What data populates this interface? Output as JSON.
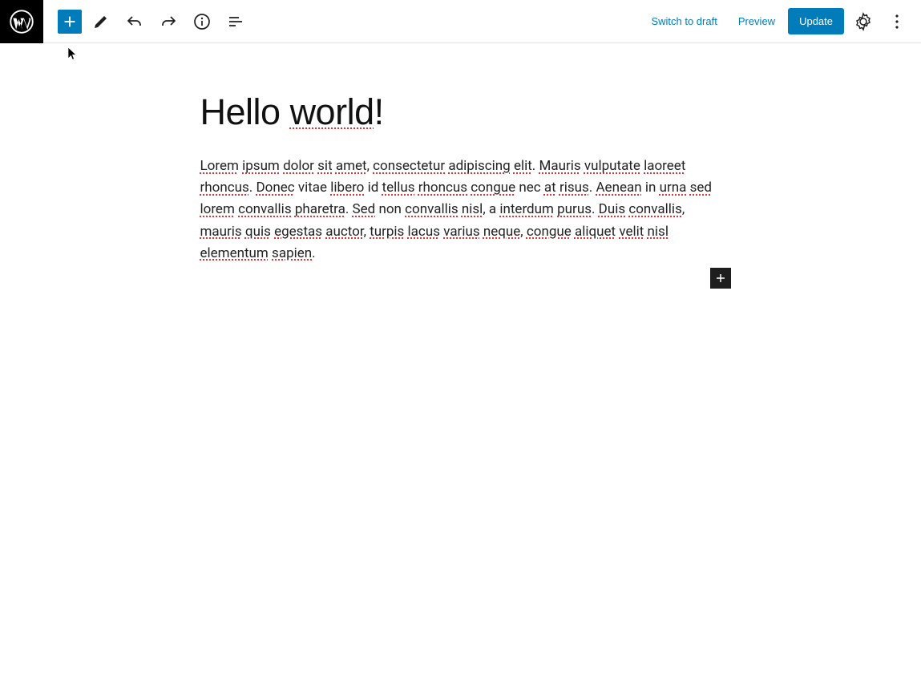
{
  "toolbar": {
    "switch_to_draft": "Switch to draft",
    "preview": "Preview",
    "update": "Update"
  },
  "post": {
    "title_prefix": "Hello ",
    "title_spell": "world",
    "title_suffix": "!",
    "body_segments": [
      {
        "t": "Lorem",
        "s": true
      },
      {
        "t": " ",
        "s": false
      },
      {
        "t": "ipsum",
        "s": true
      },
      {
        "t": " ",
        "s": false
      },
      {
        "t": "dolor",
        "s": true
      },
      {
        "t": " ",
        "s": false
      },
      {
        "t": "sit",
        "s": true
      },
      {
        "t": " ",
        "s": false
      },
      {
        "t": "amet",
        "s": true
      },
      {
        "t": ", ",
        "s": false
      },
      {
        "t": "consectetur",
        "s": true
      },
      {
        "t": " ",
        "s": false
      },
      {
        "t": "adipiscing",
        "s": true
      },
      {
        "t": " ",
        "s": false
      },
      {
        "t": "elit",
        "s": true
      },
      {
        "t": ". ",
        "s": false
      },
      {
        "t": "Mauris",
        "s": true
      },
      {
        "t": " ",
        "s": false
      },
      {
        "t": "vulputate",
        "s": true
      },
      {
        "t": " ",
        "s": false
      },
      {
        "t": "laoreet",
        "s": true
      },
      {
        "t": " ",
        "s": false
      },
      {
        "t": "rhoncus",
        "s": true
      },
      {
        "t": ". ",
        "s": false
      },
      {
        "t": "Donec",
        "s": true
      },
      {
        "t": " vitae ",
        "s": false
      },
      {
        "t": "libero",
        "s": true
      },
      {
        "t": " id ",
        "s": false
      },
      {
        "t": "tellus",
        "s": true
      },
      {
        "t": " ",
        "s": false
      },
      {
        "t": "rhoncus",
        "s": true
      },
      {
        "t": " ",
        "s": false
      },
      {
        "t": "congue",
        "s": true
      },
      {
        "t": " nec ",
        "s": false
      },
      {
        "t": "at",
        "s": true
      },
      {
        "t": " ",
        "s": false
      },
      {
        "t": "risus",
        "s": true
      },
      {
        "t": ". ",
        "s": false
      },
      {
        "t": "Aenean",
        "s": true
      },
      {
        "t": " in ",
        "s": false
      },
      {
        "t": "urna",
        "s": true
      },
      {
        "t": " ",
        "s": false
      },
      {
        "t": "sed",
        "s": true
      },
      {
        "t": " ",
        "s": false
      },
      {
        "t": "lorem",
        "s": true
      },
      {
        "t": " ",
        "s": false
      },
      {
        "t": "convallis",
        "s": true
      },
      {
        "t": " ",
        "s": false
      },
      {
        "t": "pharetra",
        "s": true
      },
      {
        "t": ". ",
        "s": false
      },
      {
        "t": "Sed",
        "s": true
      },
      {
        "t": " non ",
        "s": false
      },
      {
        "t": "convallis",
        "s": true
      },
      {
        "t": " ",
        "s": false
      },
      {
        "t": "nisl",
        "s": true
      },
      {
        "t": ", a ",
        "s": false
      },
      {
        "t": "interdum",
        "s": true
      },
      {
        "t": " ",
        "s": false
      },
      {
        "t": "purus",
        "s": true
      },
      {
        "t": ". ",
        "s": false
      },
      {
        "t": "Duis",
        "s": true
      },
      {
        "t": " ",
        "s": false
      },
      {
        "t": "convallis",
        "s": true
      },
      {
        "t": ", ",
        "s": false
      },
      {
        "t": "mauris",
        "s": true
      },
      {
        "t": " ",
        "s": false
      },
      {
        "t": "quis",
        "s": true
      },
      {
        "t": " ",
        "s": false
      },
      {
        "t": "egestas",
        "s": true
      },
      {
        "t": " ",
        "s": false
      },
      {
        "t": "auctor",
        "s": true
      },
      {
        "t": ", ",
        "s": false
      },
      {
        "t": "turpis",
        "s": true
      },
      {
        "t": " ",
        "s": false
      },
      {
        "t": "lacus",
        "s": true
      },
      {
        "t": " ",
        "s": false
      },
      {
        "t": "varius",
        "s": true
      },
      {
        "t": " ",
        "s": false
      },
      {
        "t": "neque",
        "s": true
      },
      {
        "t": ", ",
        "s": false
      },
      {
        "t": "congue",
        "s": true
      },
      {
        "t": " ",
        "s": false
      },
      {
        "t": "aliquet",
        "s": true
      },
      {
        "t": " ",
        "s": false
      },
      {
        "t": "velit",
        "s": true
      },
      {
        "t": " ",
        "s": false
      },
      {
        "t": "nisl",
        "s": true
      },
      {
        "t": " ",
        "s": false
      },
      {
        "t": "elementum",
        "s": true
      },
      {
        "t": " ",
        "s": false
      },
      {
        "t": "sapien",
        "s": true
      },
      {
        "t": ".",
        "s": false
      }
    ]
  }
}
